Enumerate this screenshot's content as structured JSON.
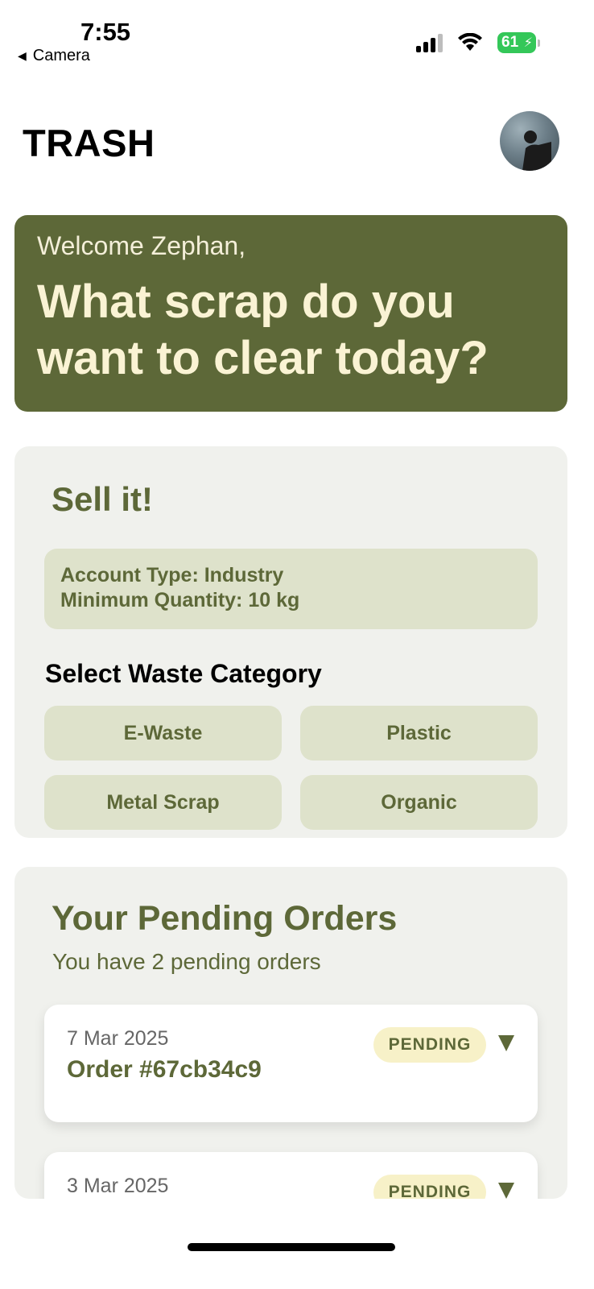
{
  "status_bar": {
    "time": "7:55",
    "back_label": "Camera",
    "battery": "61"
  },
  "header": {
    "title": "TRASH"
  },
  "banner": {
    "welcome": "Welcome Zephan,",
    "heading": "What scrap do you want to clear today?"
  },
  "sell": {
    "title": "Sell it!",
    "account_type": "Account Type: Industry",
    "min_quantity": "Minimum Quantity: 10 kg",
    "select_label": "Select Waste Category",
    "categories": [
      "E-Waste",
      "Plastic",
      "Metal Scrap",
      "Organic"
    ]
  },
  "orders": {
    "title": "Your Pending Orders",
    "subtitle": "You have 2 pending orders",
    "items": [
      {
        "date": "7 Mar 2025",
        "id": "Order #67cb34c9",
        "status": "PENDING"
      },
      {
        "date": "3 Mar 2025",
        "id": "",
        "status": "PENDING"
      }
    ]
  },
  "colors": {
    "brand_green": "#5d6838",
    "banner_text": "#faf3d4",
    "chip_bg": "#dee2cb",
    "badge_bg": "#f7f1c8",
    "card_bg": "#f0f1ed"
  }
}
